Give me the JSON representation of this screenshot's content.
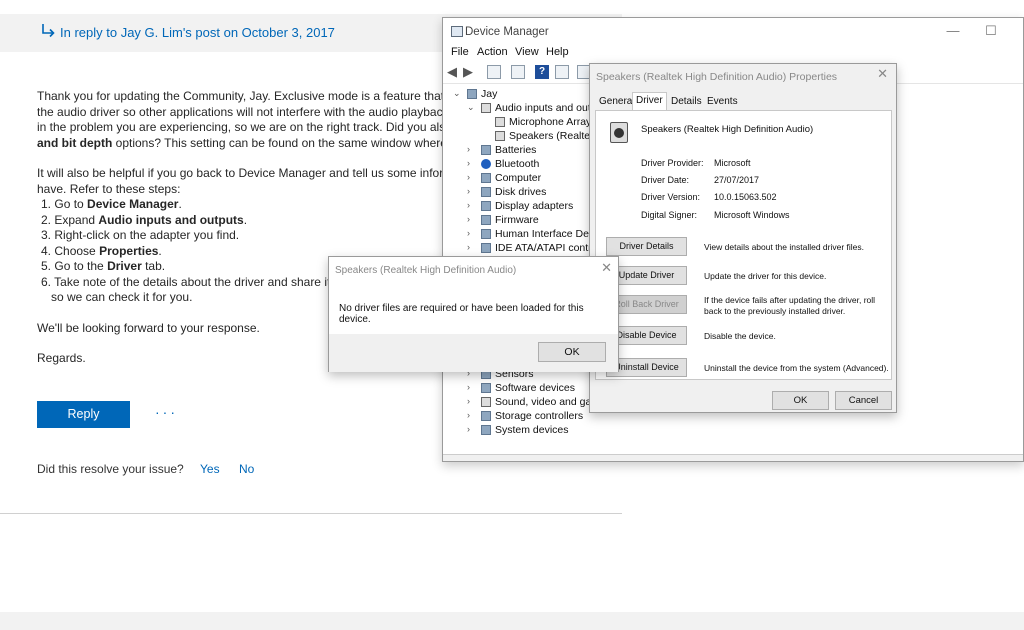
{
  "forum": {
    "reply_banner": "In reply to Jay G. Lim's post on October 3, 2017",
    "lines": [
      "Thank you for updating the Community, Jay. Exclusive mode is a feature that giv",
      "the audio driver so other applications will not interfere with the audio playback.",
      "in the problem you are experiencing, so we are on the right track. Did you also",
      "and bit depth",
      " options? This setting can be found on the same window where y",
      "It will also be helpful if you go back to Device Manager and tell us some inform",
      "have. Refer to these steps:"
    ],
    "steps": [
      {
        "num": "1.",
        "pre": "Go to ",
        "bold": "Device Manager",
        "post": "."
      },
      {
        "num": "2.",
        "pre": "Expand ",
        "bold": "Audio inputs and outputs",
        "post": "."
      },
      {
        "num": "3.",
        "pre": "Right-click on the adapter you find.",
        "bold": "",
        "post": ""
      },
      {
        "num": "4.",
        "pre": "Choose ",
        "bold": "Properties",
        "post": "."
      },
      {
        "num": "5.",
        "pre": "Go to the ",
        "bold": "Driver",
        "post": " tab."
      },
      {
        "num": "6.",
        "pre": "Take note of the details about the driver and share it h",
        "bold": "",
        "post": ""
      }
    ],
    "step6_cont": "so we can check it for you.",
    "closing": "We'll be looking forward to your response.",
    "regards": "Regards.",
    "reply_button": "Reply",
    "more_button": "···",
    "resolve_question": "Did this resolve your issue?",
    "resolve_yes": "Yes",
    "resolve_no": "No"
  },
  "device_manager": {
    "title": "Device Manager",
    "window_controls": {
      "minimize": "—",
      "maximize": "☐"
    },
    "menu": [
      "File",
      "Action",
      "View",
      "Help"
    ],
    "toolbar_icons": [
      "back-arrow-icon",
      "forward-arrow-icon",
      "properties-icon",
      "refresh-icon",
      "help-icon",
      "view-icon",
      "monitor-icon"
    ],
    "tree": [
      {
        "label": "Jay",
        "depth": 0,
        "expanded": true
      },
      {
        "label": "Audio inputs and outpu",
        "depth": 1,
        "expanded": true
      },
      {
        "label": "Microphone Array (R",
        "depth": 2
      },
      {
        "label": "Speakers (Realtek Hi",
        "depth": 2
      },
      {
        "label": "Batteries",
        "depth": 1
      },
      {
        "label": "Bluetooth",
        "depth": 1
      },
      {
        "label": "Computer",
        "depth": 1
      },
      {
        "label": "Disk drives",
        "depth": 1
      },
      {
        "label": "Display adapters",
        "depth": 1
      },
      {
        "label": "Firmware",
        "depth": 1
      },
      {
        "label": "Human Interface Device",
        "depth": 1
      },
      {
        "label": "IDE ATA/ATAPI controller",
        "depth": 1
      }
    ],
    "tree_bottom": [
      {
        "label": "Sensors",
        "depth": 1
      },
      {
        "label": "Software devices",
        "depth": 1
      },
      {
        "label": "Sound, video and game",
        "depth": 1
      },
      {
        "label": "Storage controllers",
        "depth": 1
      },
      {
        "label": "System devices",
        "depth": 1
      }
    ]
  },
  "properties": {
    "title": "Speakers (Realtek High Definition Audio) Properties",
    "close": "✕",
    "tabs": [
      "General",
      "Driver",
      "Details",
      "Events"
    ],
    "active_tab": "Driver",
    "device_name": "Speakers (Realtek High Definition Audio)",
    "info": [
      {
        "label": "Driver Provider:",
        "value": "Microsoft"
      },
      {
        "label": "Driver Date:",
        "value": "27/07/2017"
      },
      {
        "label": "Driver Version:",
        "value": "10.0.15063.502"
      },
      {
        "label": "Digital Signer:",
        "value": "Microsoft Windows"
      }
    ],
    "actions": [
      {
        "button": "Driver Details",
        "desc": "View details about the installed driver files.",
        "enabled": true
      },
      {
        "button": "Update Driver",
        "desc": "Update the driver for this device.",
        "enabled": true
      },
      {
        "button": "Roll Back Driver",
        "desc": "If the device fails after updating the driver, roll back to the previously installed driver.",
        "enabled": false
      },
      {
        "button": "Disable Device",
        "desc": "Disable the device.",
        "enabled": true
      },
      {
        "button": "Uninstall Device",
        "desc": "Uninstall the device from the system (Advanced).",
        "enabled": true
      }
    ],
    "ok": "OK",
    "cancel": "Cancel"
  },
  "message_box": {
    "title": "Speakers (Realtek High Definition Audio)",
    "close": "✕",
    "text": "No driver files are required or have been loaded for this device.",
    "ok": "OK"
  }
}
